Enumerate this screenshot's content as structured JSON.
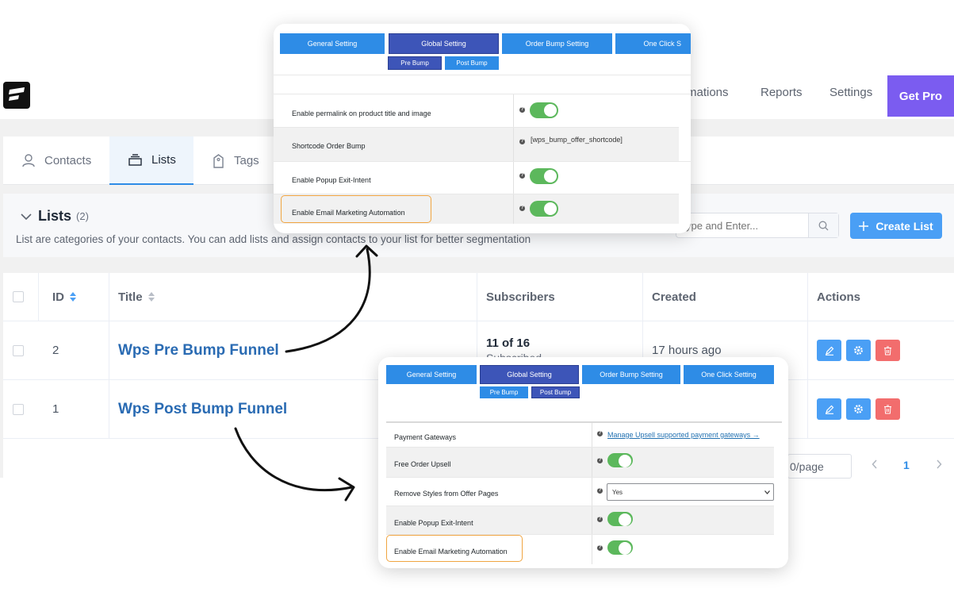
{
  "topnav": {
    "automations": "mations",
    "reports": "Reports",
    "settings": "Settings",
    "get_pro": "Get Pro"
  },
  "tabs": [
    {
      "label": "Contacts",
      "icon": "user-icon"
    },
    {
      "label": "Lists",
      "icon": "list-icon"
    },
    {
      "label": "Tags",
      "icon": "tag-icon"
    }
  ],
  "lists_header": {
    "title": "Lists",
    "count": "(2)",
    "description": "List are categories of your contacts. You can add lists and assign contacts to your list for better segmentation",
    "search_placeholder": "ype and Enter...",
    "create_button": "Create List"
  },
  "table": {
    "columns": [
      "ID",
      "Title",
      "Subscribers",
      "Created",
      "Actions"
    ],
    "rows": [
      {
        "id": "2",
        "title": "Wps Pre Bump Funnel",
        "subscribers": "11 of 16",
        "subscribers_sub": "Subscribed",
        "created": "17 hours ago"
      },
      {
        "id": "1",
        "title": "Wps Post Bump Funnel",
        "subscribers": "",
        "subscribers_sub": "",
        "created": ""
      }
    ],
    "per_page": "0/page",
    "current_page": "1"
  },
  "overlay_top": {
    "tabs": [
      "General Setting",
      "Global Setting",
      "Order Bump Setting",
      "One Click S"
    ],
    "subtabs": [
      "Pre Bump",
      "Post Bump"
    ],
    "rows": [
      {
        "label": "Enable permalink on product title and image",
        "value": ""
      },
      {
        "label": "Shortcode Order Bump",
        "value": "[wps_bump_offer_shortcode]"
      },
      {
        "label": "Enable Popup Exit-Intent",
        "value": ""
      },
      {
        "label": "Enable Email Marketing Automation",
        "value": ""
      }
    ]
  },
  "overlay_bottom": {
    "tabs": [
      "General Setting",
      "Global Setting",
      "Order Bump Setting",
      "One Click Setting"
    ],
    "subtabs": [
      "Pre Bump",
      "Post Bump"
    ],
    "rows": [
      {
        "label": "Payment Gateways",
        "value": "Manage Upsell supported payment gateways →"
      },
      {
        "label": "Free Order Upsell",
        "value": ""
      },
      {
        "label": "Remove Styles from Offer Pages",
        "value": "Yes"
      },
      {
        "label": "Enable Popup Exit-Intent",
        "value": ""
      },
      {
        "label": "Enable Email Marketing Automation",
        "value": ""
      }
    ]
  },
  "colors": {
    "accent": "#2e8ce6",
    "get_pro": "#7b5cf0",
    "toggle_on": "#5cb85c",
    "highlight": "#f0a541",
    "delete": "#f26d6d"
  }
}
